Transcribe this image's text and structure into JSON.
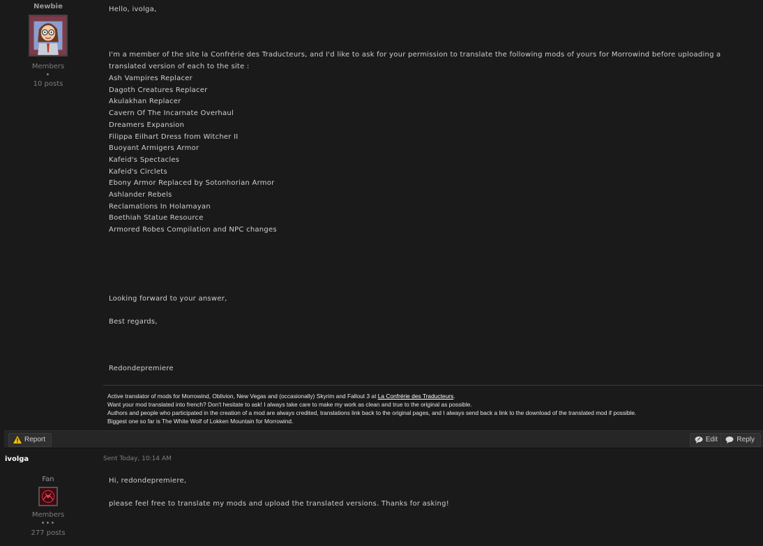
{
  "post1": {
    "author": {
      "rank": "Newbie",
      "group": "Members",
      "pips": "•",
      "post_count": "10 posts"
    },
    "body": {
      "greeting": "Hello, ivolga,",
      "intro": "I'm a member of the site la Confrérie des Traducteurs, and I'd like to ask for your permission to translate the following mods of yours for Morrowind before uploading a translated version of each to the site :",
      "mods": [
        "Ash Vampires Replacer",
        "Dagoth Creatures Replacer",
        "Akulakhan Replacer",
        "Cavern Of The Incarnate Overhaul",
        "Dreamers Expansion",
        "Filippa Eilhart Dress from Witcher II",
        "Buoyant Armigers Armor",
        "Kafeid's Spectacles",
        "Kafeid's Circlets",
        "Ebony Armor Replaced by Sotonhorian Armor",
        "Ashlander Rebels",
        "Reclamations In Holamayan",
        "Boethiah Statue Resource",
        "Armored Robes Compilation and NPC changes"
      ],
      "closing1": "Looking forward to your answer,",
      "closing2": "Best regards,",
      "signoff": "Redondepremiere"
    },
    "signature": {
      "line1_prefix": "Active translator of mods for Morrowind, Oblivion, New Vegas and (occasionally) Skyrim and Fallout 3 at ",
      "line1_link": "La Confrérie des Traducteurs",
      "line1_suffix": ".",
      "line2": "Want your mod translated into french? Don't hesitate to ask! I always take care to make my work as clean and true to the original as possible.",
      "line3": "Authors and people who participated in the creation of a mod are always credited, translations link back to the original pages, and I always send back a link to the download of the translated mod if possible.",
      "line4": "Biggest one so far is The White Wolf of Lokken Mountain for Morrowind."
    },
    "toolbar": {
      "report_label": "Report",
      "edit_label": "Edit",
      "reply_label": "Reply"
    }
  },
  "post2": {
    "username": "ivolga",
    "sent": "Sent Today, 10:14 AM",
    "author": {
      "rank": "Fan",
      "group": "Members",
      "pips": "•••",
      "post_count": "277 posts"
    },
    "body": {
      "greeting": "Hi, redondepremiere,",
      "message": "please feel free to translate my mods and upload the translated versions. Thanks for asking!"
    }
  },
  "icons": {
    "report": "warning-icon",
    "edit": "speech-bubble-icon",
    "reply": "speech-bubble-icon"
  },
  "colors": {
    "background": "#1a1a1a",
    "toolbar": "#262626",
    "text": "#cfcfcf",
    "muted": "#7d7d7d",
    "warning_icon": "#f2c200"
  }
}
